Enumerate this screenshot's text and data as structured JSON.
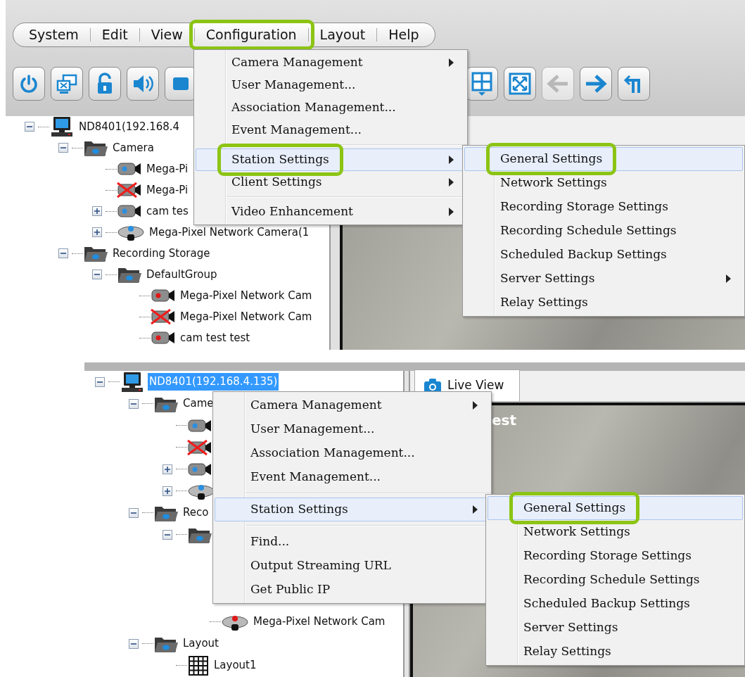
{
  "top_screenshot": {
    "menubar": [
      {
        "label": "System",
        "annotated": false
      },
      {
        "label": "Edit",
        "annotated": false
      },
      {
        "label": "View",
        "annotated": false
      },
      {
        "label": "Configuration",
        "annotated": true
      },
      {
        "label": "Layout",
        "annotated": false
      },
      {
        "label": "Help",
        "annotated": false
      }
    ],
    "toolbar": {
      "left": [
        {
          "kind": "power",
          "disabled": false
        },
        {
          "kind": "monitor_x",
          "disabled": false
        },
        {
          "kind": "lock",
          "disabled": false
        },
        {
          "kind": "speaker",
          "disabled": false
        },
        {
          "kind": "square",
          "disabled": false
        }
      ],
      "right": [
        {
          "kind": "grid",
          "disabled": false
        },
        {
          "kind": "fullscreen",
          "disabled": false
        },
        {
          "kind": "arrow_left",
          "disabled": true
        },
        {
          "kind": "arrow_right",
          "disabled": false
        },
        {
          "kind": "return",
          "disabled": false
        }
      ]
    },
    "tree": [
      {
        "kind": "computer",
        "label": "ND8401(192.168.4",
        "expanded": true,
        "selected": false,
        "children": [
          {
            "kind": "folder",
            "label": "Camera",
            "expanded": true,
            "selected": false,
            "children": [
              {
                "kind": "camera",
                "label": "Mega-Pi",
                "color": "#2a8fe0",
                "selected": false
              },
              {
                "kind": "camera_offline",
                "label": "Mega-Pi",
                "selected": false
              },
              {
                "kind": "camera",
                "label": "cam tes",
                "color": "#2a8fe0",
                "expanded": false,
                "selected": false
              },
              {
                "kind": "dome",
                "label": "Mega-Pixel Network Camera(1",
                "color": "#2a8fe0",
                "expanded": false,
                "selected": false
              }
            ]
          },
          {
            "kind": "folder",
            "label": "Recording Storage",
            "expanded": true,
            "selected": false,
            "children": [
              {
                "kind": "folder",
                "label": "DefaultGroup",
                "expanded": true,
                "selected": false,
                "children": [
                  {
                    "kind": "camera",
                    "label": "Mega-Pixel Network Cam",
                    "color": "#e01818",
                    "selected": false
                  },
                  {
                    "kind": "camera_offline",
                    "label": "Mega-Pixel Network Cam",
                    "selected": false
                  },
                  {
                    "kind": "camera",
                    "label": "cam test test",
                    "color": "#e01818",
                    "selected": false
                  }
                ]
              }
            ]
          }
        ]
      }
    ],
    "menu": [
      {
        "kind": "item",
        "label": "Camera Management",
        "submenu": true,
        "selected": false,
        "annotated": false
      },
      {
        "kind": "item",
        "label": "User Management...",
        "submenu": false,
        "selected": false,
        "annotated": false
      },
      {
        "kind": "item",
        "label": "Association Management...",
        "submenu": false,
        "selected": false,
        "annotated": false
      },
      {
        "kind": "item",
        "label": "Event Management...",
        "submenu": false,
        "selected": false,
        "annotated": false
      },
      {
        "kind": "separator"
      },
      {
        "kind": "item",
        "label": "Station Settings",
        "submenu": true,
        "selected": true,
        "annotated": true
      },
      {
        "kind": "item",
        "label": "Client Settings",
        "submenu": true,
        "selected": false,
        "annotated": false
      },
      {
        "kind": "separator"
      },
      {
        "kind": "item",
        "label": "Video Enhancement",
        "submenu": true,
        "selected": false,
        "annotated": false
      }
    ],
    "submenu": [
      {
        "kind": "item",
        "label": "General Settings",
        "submenu": false,
        "selected": true,
        "annotated": true
      },
      {
        "kind": "item",
        "label": "Network Settings",
        "submenu": false,
        "selected": false,
        "annotated": false
      },
      {
        "kind": "item",
        "label": "Recording Storage Settings",
        "submenu": false,
        "selected": false,
        "annotated": false
      },
      {
        "kind": "item",
        "label": "Recording Schedule Settings",
        "submenu": false,
        "selected": false,
        "annotated": false
      },
      {
        "kind": "item",
        "label": "Scheduled Backup Settings",
        "submenu": false,
        "selected": false,
        "annotated": false
      },
      {
        "kind": "item",
        "label": "Server Settings",
        "submenu": true,
        "selected": false,
        "annotated": false
      },
      {
        "kind": "item",
        "label": "Relay Settings",
        "submenu": false,
        "selected": false,
        "annotated": false
      }
    ]
  },
  "bottom_screenshot": {
    "tree": [
      {
        "kind": "computer",
        "label": "ND8401(192.168.4.135)",
        "expanded": true,
        "selected": true,
        "children": [
          {
            "kind": "folder",
            "label": "Came",
            "expanded": true,
            "selected": false,
            "children": [
              {
                "kind": "camera",
                "color": "#2a8fe0"
              },
              {
                "kind": "camera_offline"
              },
              {
                "kind": "camera",
                "color": "#2a8fe0",
                "expanded": false
              },
              {
                "kind": "dome",
                "color": "#2a8fe0",
                "expanded": false
              }
            ]
          },
          {
            "kind": "folder",
            "label": "Reco",
            "expanded": true,
            "selected": false,
            "children": [
              {
                "kind": "folder",
                "expanded": true,
                "children": [
                  {
                    "kind": "dome",
                    "label": "Mega-Pixel Network Cam",
                    "color": "#e01818",
                    "selected": false
                  }
                ]
              }
            ]
          },
          {
            "kind": "folder",
            "label": "Layout",
            "expanded": true,
            "selected": false,
            "children": [
              {
                "kind": "layout",
                "label": "Layout1",
                "selected": false
              }
            ]
          }
        ]
      }
    ],
    "tab": {
      "label": "Live View",
      "selected": true
    },
    "video_caption": "est",
    "menu": [
      {
        "kind": "item",
        "label": "Camera Management",
        "submenu": true,
        "selected": false,
        "annotated": false
      },
      {
        "kind": "item",
        "label": "User Management...",
        "submenu": false,
        "selected": false,
        "annotated": false
      },
      {
        "kind": "item",
        "label": "Association Management...",
        "submenu": false,
        "selected": false,
        "annotated": false
      },
      {
        "kind": "item",
        "label": "Event Management...",
        "submenu": false,
        "selected": false,
        "annotated": false
      },
      {
        "kind": "separator"
      },
      {
        "kind": "item",
        "label": "Station Settings",
        "submenu": true,
        "selected": true,
        "annotated": false
      },
      {
        "kind": "separator"
      },
      {
        "kind": "item",
        "label": "Find...",
        "submenu": false,
        "selected": false,
        "annotated": false
      },
      {
        "kind": "item",
        "label": "Output Streaming URL",
        "submenu": false,
        "selected": false,
        "annotated": false
      },
      {
        "kind": "item",
        "label": "Get Public IP",
        "submenu": false,
        "selected": false,
        "annotated": false
      }
    ],
    "submenu": [
      {
        "kind": "item",
        "label": "General Settings",
        "submenu": false,
        "selected": true,
        "annotated": true
      },
      {
        "kind": "item",
        "label": "Network Settings",
        "submenu": false,
        "selected": false,
        "annotated": false
      },
      {
        "kind": "item",
        "label": "Recording Storage Settings",
        "submenu": false,
        "selected": false,
        "annotated": false
      },
      {
        "kind": "item",
        "label": "Recording Schedule Settings",
        "submenu": false,
        "selected": false,
        "annotated": false
      },
      {
        "kind": "item",
        "label": "Scheduled Backup Settings",
        "submenu": false,
        "selected": false,
        "annotated": false
      },
      {
        "kind": "item",
        "label": "Server Settings",
        "submenu": false,
        "selected": false,
        "annotated": false
      },
      {
        "kind": "item",
        "label": "Relay Settings",
        "submenu": false,
        "selected": false,
        "annotated": false
      }
    ]
  }
}
